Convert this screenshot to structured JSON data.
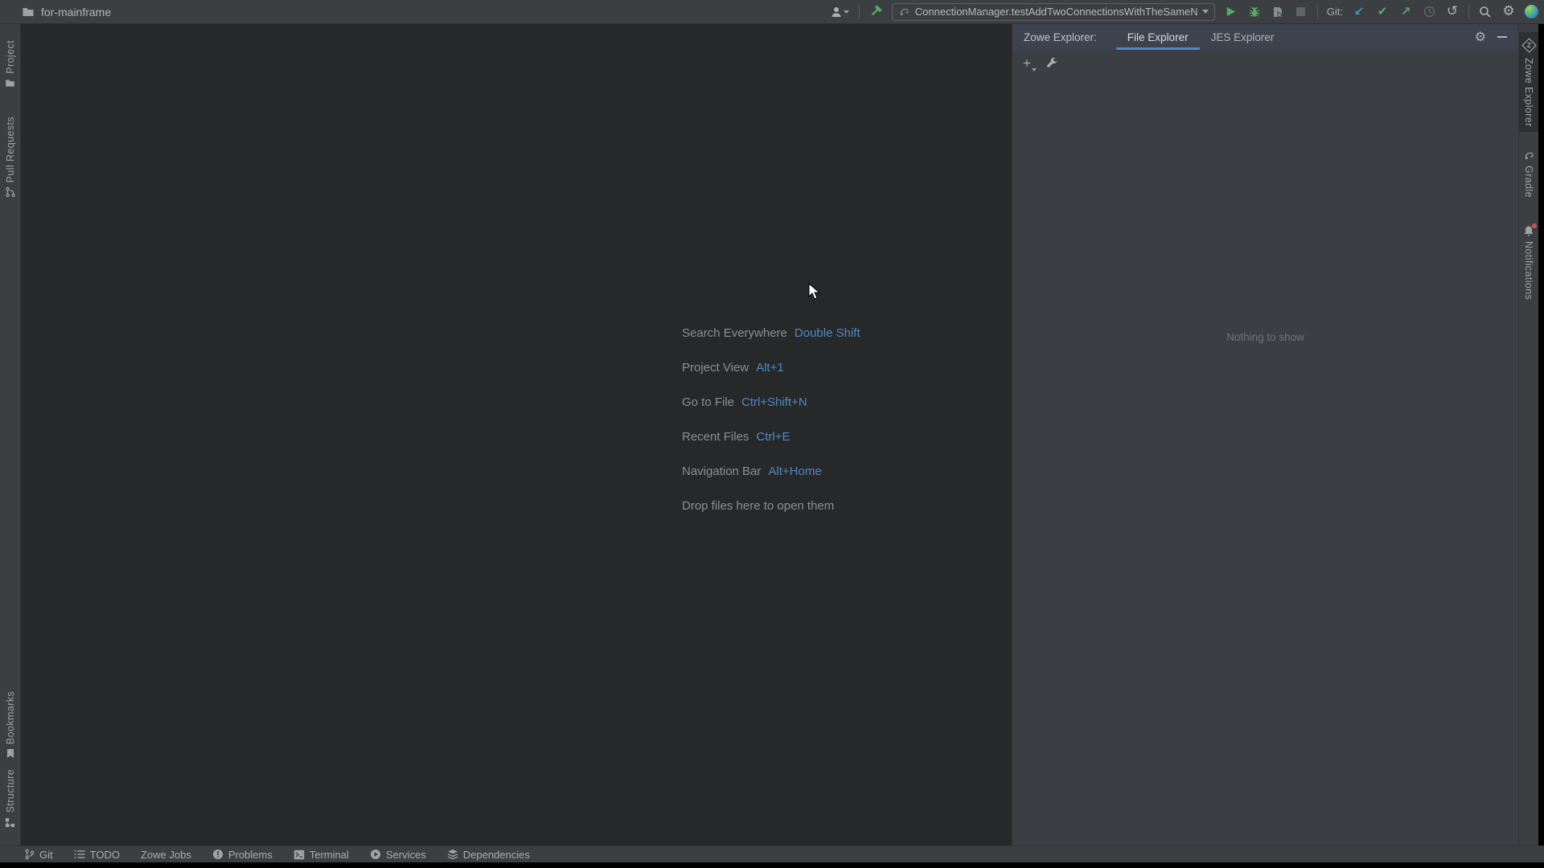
{
  "window": {
    "project_name": "for-mainframe"
  },
  "toolbar": {
    "run_config": "ConnectionManager.testAddTwoConnectionsWithTheSameName",
    "git_label": "Git:"
  },
  "icons": {
    "update_glyph": "↙",
    "commit_glyph": "✔",
    "push_glyph": "↗",
    "rollback_glyph": "↺",
    "gear_glyph": "⚙",
    "plus_glyph": "+"
  },
  "left_stripe": {
    "project": "Project",
    "pull_requests": "Pull Requests",
    "bookmarks": "Bookmarks",
    "structure": "Structure"
  },
  "editor": {
    "shortcuts": [
      {
        "label": "Search Everywhere",
        "keys": "Double Shift"
      },
      {
        "label": "Project View",
        "keys": "Alt+1"
      },
      {
        "label": "Go to File",
        "keys": "Ctrl+Shift+N"
      },
      {
        "label": "Recent Files",
        "keys": "Ctrl+E"
      },
      {
        "label": "Navigation Bar",
        "keys": "Alt+Home"
      }
    ],
    "drop_hint": "Drop files here to open them"
  },
  "zowe_panel": {
    "title": "Zowe Explorer:",
    "tabs": [
      {
        "label": "File Explorer"
      },
      {
        "label": "JES Explorer"
      }
    ],
    "empty_text": "Nothing to show"
  },
  "right_stripe": {
    "zowe": "Zowe Explorer",
    "gradle": "Gradle",
    "notifications": "Notifications"
  },
  "status_bar": {
    "items": [
      "Git",
      "TODO",
      "Zowe Jobs",
      "Problems",
      "Terminal",
      "Services",
      "Dependencies"
    ]
  },
  "colors": {
    "accent_blue": "#4A88C7",
    "run_green": "#59A869",
    "update_blue": "#4393C9",
    "error_red": "#C75450",
    "editor_bg": "#262829",
    "panel_bg": "#3B3E42",
    "chrome_bg": "#3C3F41"
  }
}
